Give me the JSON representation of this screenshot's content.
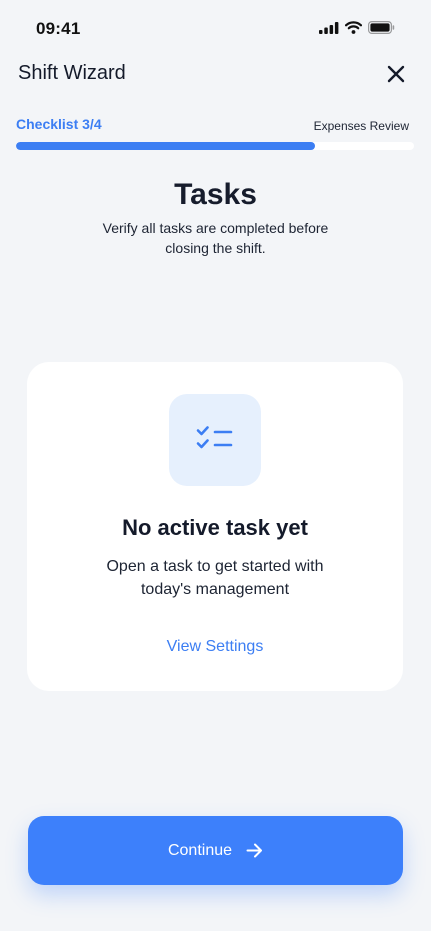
{
  "status_bar": {
    "time": "09:41",
    "icons": [
      "signal-icon",
      "wifi-icon",
      "battery-icon"
    ]
  },
  "header": {
    "title": "Shift Wizard",
    "close_icon": "close-icon"
  },
  "progress": {
    "label": "Checklist 3/4",
    "next_step": "Expenses Review",
    "fraction": 0.75,
    "accent_color": "#3c7ef3"
  },
  "section": {
    "title": "Tasks",
    "subtitle": "Verify all tasks are completed before closing the shift."
  },
  "empty_state": {
    "icon": "checklist-icon",
    "title": "No active task yet",
    "text": "Open a task to get started with today's management",
    "link_label": "View Settings"
  },
  "footer": {
    "continue_label": "Continue",
    "continue_icon": "arrow-right-icon",
    "button_color": "#3d80fb"
  }
}
